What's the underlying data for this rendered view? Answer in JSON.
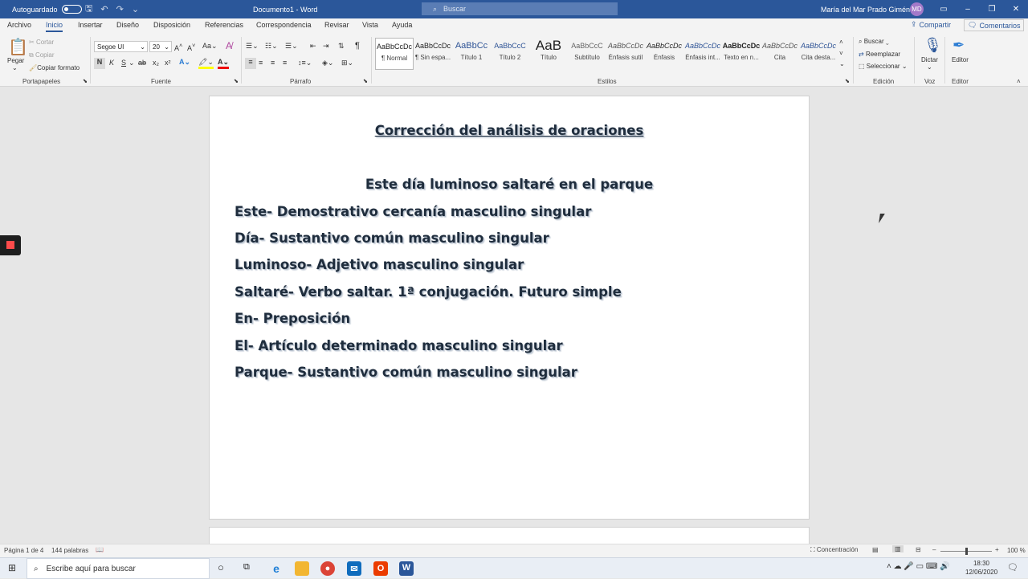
{
  "titlebar": {
    "autosave_label": "Autoguardado",
    "doc_title": "Documento1 - Word",
    "search_placeholder": "Buscar",
    "user_name": "María del Mar Prado Giménez",
    "user_initials": "MD"
  },
  "menu": {
    "tabs": [
      "Archivo",
      "Inicio",
      "Insertar",
      "Diseño",
      "Disposición",
      "Referencias",
      "Correspondencia",
      "Revisar",
      "Vista",
      "Ayuda"
    ],
    "active": "Inicio",
    "share": "Compartir",
    "comments": "Comentarios"
  },
  "ribbon": {
    "clipboard": {
      "paste": "Pegar",
      "cut": "Cortar",
      "copy": "Copiar",
      "format_painter": "Copiar formato",
      "label": "Portapapeles"
    },
    "font": {
      "name": "Segoe UI",
      "size": "20",
      "label": "Fuente",
      "bold": "N",
      "italic": "K",
      "underline": "S"
    },
    "paragraph": {
      "label": "Párrafo"
    },
    "styles": {
      "label": "Estilos",
      "items": [
        {
          "preview": "AaBbCcDc",
          "name": "¶ Normal"
        },
        {
          "preview": "AaBbCcDc",
          "name": "¶ Sin espa..."
        },
        {
          "preview": "AaBbCc",
          "name": "Título 1"
        },
        {
          "preview": "AaBbCcC",
          "name": "Título 2"
        },
        {
          "preview": "AaB",
          "name": "Título"
        },
        {
          "preview": "AaBbCcC",
          "name": "Subtítulo"
        },
        {
          "preview": "AaBbCcDc",
          "name": "Énfasis sutil"
        },
        {
          "preview": "AaBbCcDc",
          "name": "Énfasis"
        },
        {
          "preview": "AaBbCcDc",
          "name": "Énfasis int..."
        },
        {
          "preview": "AaBbCcDc",
          "name": "Texto en n..."
        },
        {
          "preview": "AaBbCcDc",
          "name": "Cita"
        },
        {
          "preview": "AaBbCcDc",
          "name": "Cita desta..."
        }
      ]
    },
    "editing": {
      "find": "Buscar",
      "replace": "Reemplazar",
      "select": "Seleccionar",
      "label": "Edición"
    },
    "voice": {
      "dictate": "Dictar",
      "label": "Voz"
    },
    "editor": {
      "button": "Editor",
      "label": "Editor"
    }
  },
  "document": {
    "title": "Corrección del análisis de oraciones",
    "sentence": "Este día luminoso saltaré en el parque",
    "lines": [
      "Este- Demostrativo cercanía masculino singular",
      "Día- Sustantivo común masculino singular",
      "Luminoso- Adjetivo masculino singular",
      "Saltaré- Verbo saltar. 1ª conjugación. Futuro simple",
      "En- Preposición",
      "El- Artículo determinado masculino singular",
      "Parque- Sustantivo común masculino singular"
    ]
  },
  "statusbar": {
    "page": "Página 1 de 4",
    "words": "144 palabras",
    "focus": "Concentración",
    "zoom": "100 %"
  },
  "taskbar": {
    "search_placeholder": "Escribe aquí para buscar",
    "time": "18:30",
    "date": "12/06/2020"
  }
}
